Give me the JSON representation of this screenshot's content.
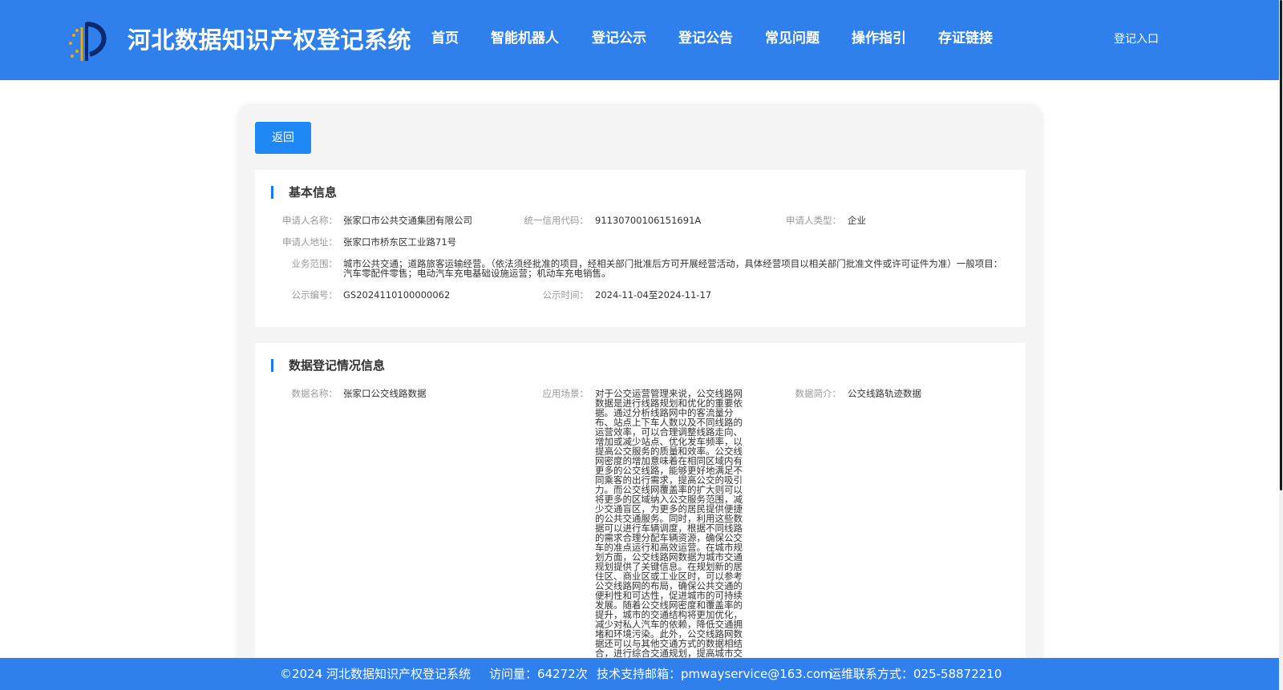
{
  "header": {
    "title": "河北数据知识产权登记系统",
    "nav": [
      "首页",
      "智能机器人",
      "登记公示",
      "登记公告",
      "常见问题",
      "操作指引",
      "存证链接"
    ],
    "login": "登记入口"
  },
  "back_label": "返回",
  "basic": {
    "title": "基本信息",
    "applicant_name_label": "申请人名称：",
    "applicant_name": "张家口市公共交通集团有限公司",
    "credit_code_label": "统一信用代码：",
    "credit_code": "91130700106151691A",
    "applicant_type_label": "申请人类型：",
    "applicant_type": "企业",
    "address_label": "申请人地址：",
    "address": "张家口市桥东区工业路71号",
    "scope_label": "业务范围：",
    "scope": "城市公共交通；道路旅客运输经营。（依法须经批准的项目，经相关部门批准后方可开展经营活动，具体经营项目以相关部门批准文件或许可证件为准）一般项目：汽车零配件零售；电动汽车充电基础设施运营；机动车充电销售。",
    "pub_no_label": "公示编号：",
    "pub_no": "GS2024110100000062",
    "pub_time_label": "公示时间：",
    "pub_time": "2024-11-04至2024-11-17"
  },
  "data_reg": {
    "title": "数据登记情况信息",
    "data_name_label": "数据名称：",
    "data_name": "张家口公交线路数据",
    "scene_label": "应用场景：",
    "scene": "对于公交运营管理来说，公交线路网数据是进行线路规划和优化的重要依据。通过分析线路网中的客流量分布、站点上下车人数以及不同线路的运营效率，可以合理调整线路走向、增加或减少站点、优化发车频率，以提高公交服务的质量和效率。公交线网密度的增加意味着在相同区域内有更多的公交线路，能够更好地满足不同乘客的出行需求，提高公交的吸引力。而公交线网覆盖率的扩大则可以将更多的区域纳入公交服务范围，减少交通盲区，为更多的居民提供便捷的公共交通服务。同时，利用这些数据可以进行车辆调度，根据不同线路的需求合理分配车辆资源，确保公交车的准点运行和高效运营。在城市规划方面，公交线路网数据为城市交通规划提供了关键信息。在规划新的居住区、商业区或工业区时，可以参考公交线路网的布局，确保公共交通的便利性和可达性，促进城市的可持续发展。随着公交线网密度和覆盖率的提升，城市的交通结构将更加优化，减少对私人汽车的依赖，降低交通拥堵和环境污染。此外，公交线路网数据还可以与其他交通方式的数据相结合，进行综合交通规划，提高城市交",
    "summary_label": "数据简介：",
    "summary": "公交线路轨迹数据"
  },
  "footer": {
    "copyright": "©2024 河北数据知识产权登记系统",
    "visits": "访问量：64272次",
    "email": "技术支持邮箱：pmwayservice@163.com",
    "contact": "运维联系方式：025-58872210"
  },
  "colors": {
    "header_bg": "#2f80ed",
    "button_bg": "#1e88f5",
    "accent_bar": "#1677ff"
  }
}
